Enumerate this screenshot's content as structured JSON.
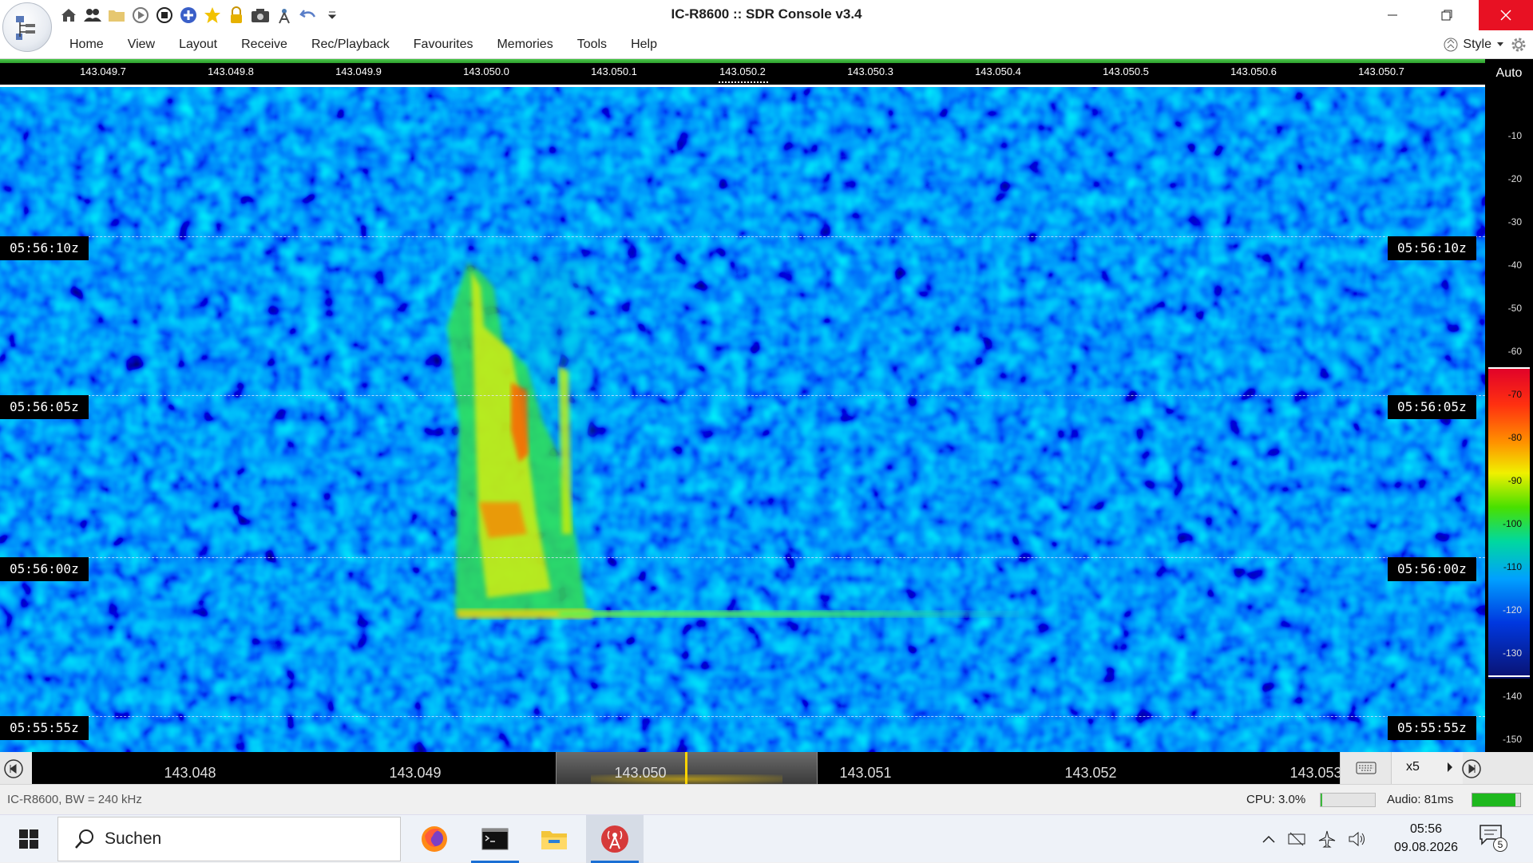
{
  "window": {
    "title": "IC-R8600 :: SDR Console v3.4"
  },
  "quick_access": [
    {
      "icon": "home-icon"
    },
    {
      "icon": "users-icon"
    },
    {
      "icon": "folder-icon"
    },
    {
      "icon": "play-icon"
    },
    {
      "icon": "stop-icon"
    },
    {
      "icon": "add-icon"
    },
    {
      "icon": "star-icon"
    },
    {
      "icon": "lock-icon"
    },
    {
      "icon": "camera-icon"
    },
    {
      "icon": "antenna-icon"
    },
    {
      "icon": "undo-icon"
    },
    {
      "icon": "customize-icon"
    }
  ],
  "menu": {
    "items": [
      "Home",
      "View",
      "Layout",
      "Receive",
      "Rec/Playback",
      "Favourites",
      "Memories",
      "Tools",
      "Help"
    ],
    "style_label": "Style"
  },
  "top_ruler": {
    "labels": [
      "143.049.7",
      "143.049.8",
      "143.049.9",
      "143.050.0",
      "143.050.1",
      "143.050.2",
      "143.050.3",
      "143.050.4",
      "143.050.5",
      "143.050.6",
      "143.050.7"
    ],
    "auto_label": "Auto"
  },
  "waterfall": {
    "time_marks": [
      "05:56:10z",
      "05:56:05z",
      "05:56:00z",
      "05:55:55z"
    ],
    "signal_color_start": "#ff4000",
    "signal_color_mid": "#f2f200",
    "signal_color_low": "#30e030",
    "background_color": "#0a2fa8"
  },
  "scale": {
    "labels": [
      "-10",
      "-20",
      "-30",
      "-40",
      "-50",
      "-60",
      "-70",
      "-80",
      "-90",
      "-100",
      "-110",
      "-120",
      "-130",
      "-140",
      "-150"
    ]
  },
  "nav_ruler": {
    "labels": [
      "143.048",
      "143.049",
      "143.050",
      "143.051",
      "143.052",
      "143.053"
    ],
    "zoom": "x5"
  },
  "status": {
    "device": "IC-R8600, BW = 240 kHz",
    "cpu": "CPU: 3.0%",
    "cpu_level": 0.03,
    "audio": "Audio: 81ms",
    "audio_level": 0.9
  },
  "taskbar": {
    "search_placeholder": "Suchen",
    "apps": [
      "firefox-icon",
      "terminal-icon",
      "file-explorer-icon",
      "sdr-console-icon"
    ],
    "time": "05:56",
    "date": "09.08.2026",
    "notifications": "5"
  }
}
